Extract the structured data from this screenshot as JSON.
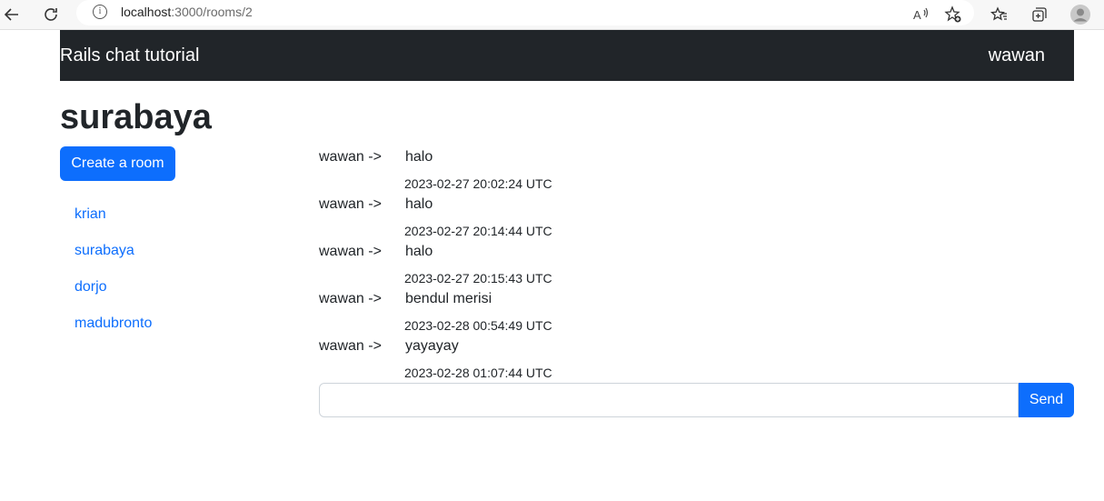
{
  "browser": {
    "url_host": "localhost",
    "url_path": ":3000/rooms/2",
    "icons": [
      "back-icon",
      "refresh-icon",
      "info-icon",
      "read-aloud-icon",
      "add-favorite-icon",
      "favorites-icon",
      "collections-icon",
      "profile-icon"
    ]
  },
  "navbar": {
    "brand": "Rails chat tutorial",
    "user": "wawan"
  },
  "room": {
    "title": "surabaya",
    "create_button": "Create a room"
  },
  "rooms": [
    {
      "label": "krian"
    },
    {
      "label": "surabaya"
    },
    {
      "label": "dorjo"
    },
    {
      "label": "madubronto"
    }
  ],
  "messages": [
    {
      "sender": "wawan ->",
      "text": "halo",
      "time": "2023-02-27 20:02:24 UTC"
    },
    {
      "sender": "wawan ->",
      "text": "halo",
      "time": "2023-02-27 20:14:44 UTC"
    },
    {
      "sender": "wawan ->",
      "text": "halo",
      "time": "2023-02-27 20:15:43 UTC"
    },
    {
      "sender": "wawan ->",
      "text": "bendul merisi",
      "time": "2023-02-28 00:54:49 UTC"
    },
    {
      "sender": "wawan ->",
      "text": "yayayay",
      "time": "2023-02-28 01:07:44 UTC"
    }
  ],
  "chat_form": {
    "input_value": "",
    "send_label": "Send"
  },
  "colors": {
    "navbar_bg": "#212529",
    "primary": "#0d6efd",
    "link": "#0d6efd"
  }
}
